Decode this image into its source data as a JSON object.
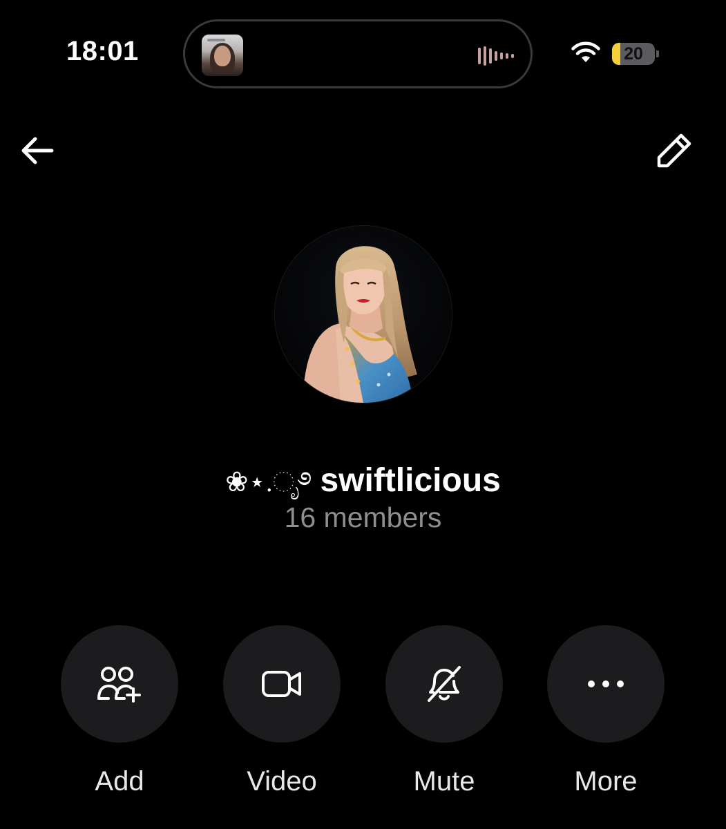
{
  "status_bar": {
    "time": "18:01",
    "battery_percent": "20",
    "battery_level": 0.2,
    "wifi_icon": "wifi-icon",
    "now_playing_icon": "waveform-icon"
  },
  "header": {
    "back_icon": "arrow-left-icon",
    "edit_icon": "pencil-icon"
  },
  "group": {
    "decoration": "❀⋆.ೃ࿔",
    "name": "swiftlicious",
    "members": "16 members"
  },
  "actions": [
    {
      "label": "Add",
      "icon": "add-people-icon"
    },
    {
      "label": "Video",
      "icon": "video-camera-icon"
    },
    {
      "label": "Mute",
      "icon": "bell-slash-icon"
    },
    {
      "label": "More",
      "icon": "more-dots-icon"
    }
  ],
  "colors": {
    "background": "#000000",
    "button_bg": "#1c1c1e",
    "secondary_text": "#8e8e93",
    "battery_yellow": "#f5cf3a"
  }
}
